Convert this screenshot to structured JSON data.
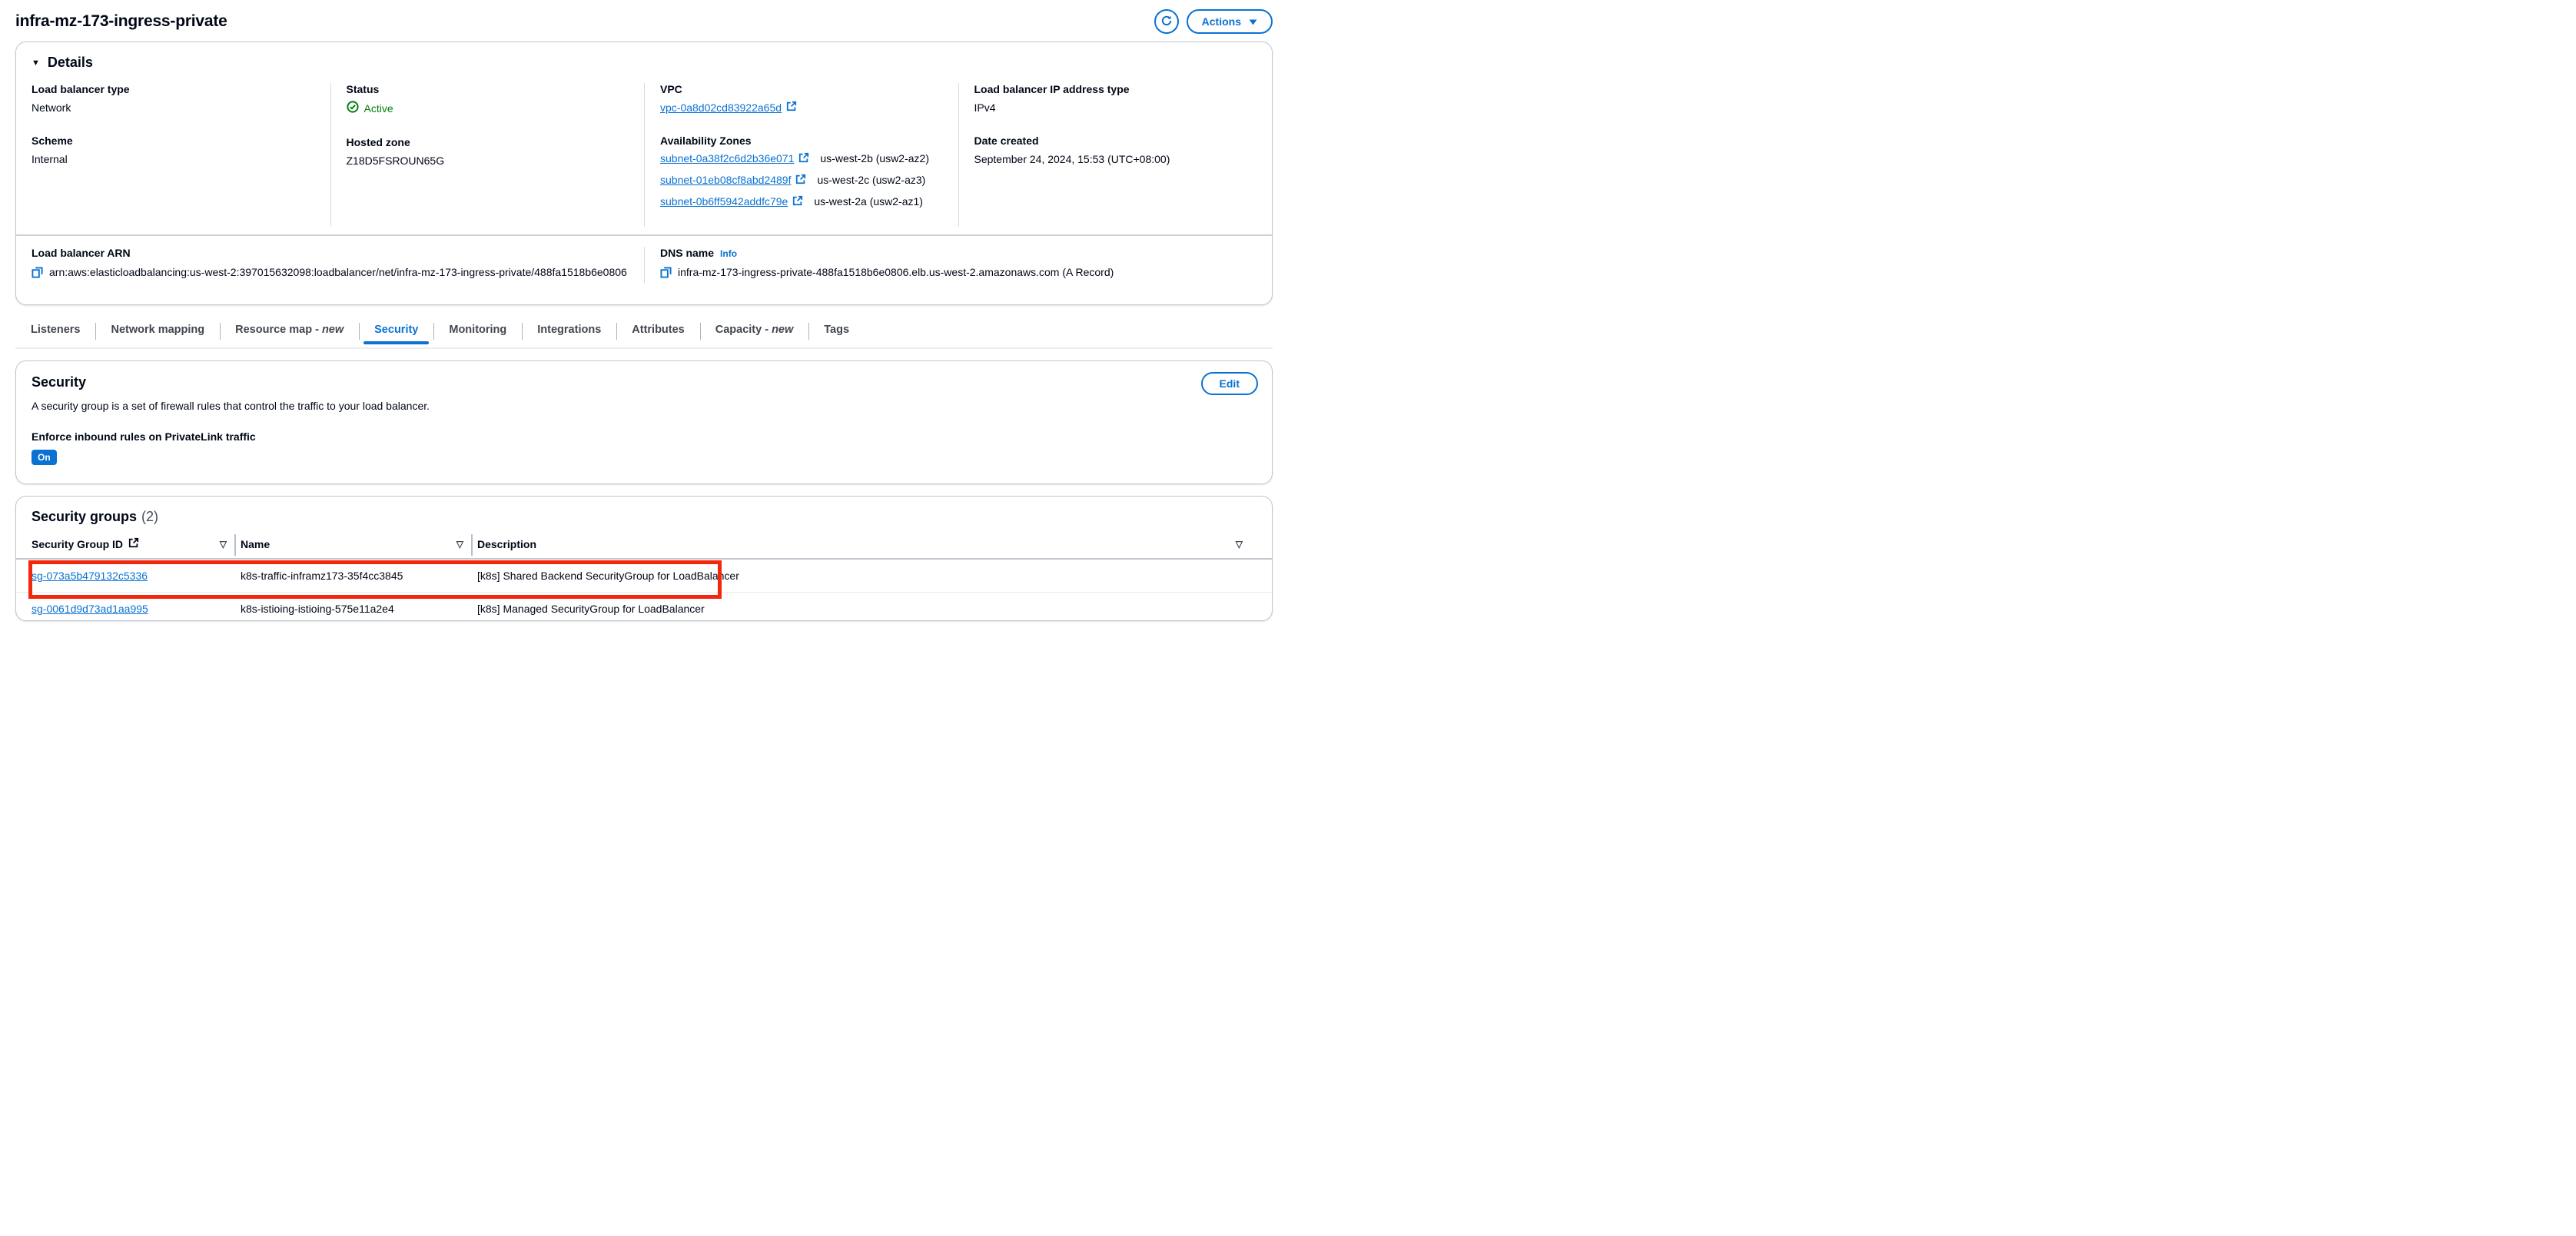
{
  "colors": {
    "accent": "#0972d3",
    "success": "#037f0c",
    "annotation": "#f2270c"
  },
  "header": {
    "title": "infra-mz-173-ingress-private",
    "actions_label": "Actions"
  },
  "details": {
    "title": "Details",
    "lb_type_label": "Load balancer type",
    "lb_type_value": "Network",
    "scheme_label": "Scheme",
    "scheme_value": "Internal",
    "status_label": "Status",
    "status_value": "Active",
    "hosted_zone_label": "Hosted zone",
    "hosted_zone_value": "Z18D5FSROUN65G",
    "vpc_label": "VPC",
    "vpc_link": "vpc-0a8d02cd83922a65d",
    "az_label": "Availability Zones",
    "subnets": [
      {
        "link": "subnet-0a38f2c6d2b36e071",
        "zone": "us-west-2b (usw2-az2)"
      },
      {
        "link": "subnet-01eb08cf8abd2489f",
        "zone": "us-west-2c (usw2-az3)"
      },
      {
        "link": "subnet-0b6ff5942addfc79e",
        "zone": "us-west-2a (usw2-az1)"
      }
    ],
    "ip_type_label": "Load balancer IP address type",
    "ip_type_value": "IPv4",
    "date_created_label": "Date created",
    "date_created_value": "September 24, 2024, 15:53 (UTC+08:00)",
    "arn_label": "Load balancer ARN",
    "arn_value": "arn:aws:elasticloadbalancing:us-west-2:397015632098:loadbalancer/net/infra-mz-173-ingress-private/488fa1518b6e0806",
    "dns_label": "DNS name",
    "dns_info": "Info",
    "dns_value": "infra-mz-173-ingress-private-488fa1518b6e0806.elb.us-west-2.amazonaws.com (A Record)"
  },
  "tabs": [
    {
      "label": "Listeners"
    },
    {
      "label": "Network mapping"
    },
    {
      "label": "Resource map -",
      "suffix": "new"
    },
    {
      "label": "Security",
      "active": true
    },
    {
      "label": "Monitoring"
    },
    {
      "label": "Integrations"
    },
    {
      "label": "Attributes"
    },
    {
      "label": "Capacity -",
      "suffix": "new"
    },
    {
      "label": "Tags"
    }
  ],
  "security": {
    "title": "Security",
    "edit_label": "Edit",
    "description": "A security group is a set of firewall rules that control the traffic to your load balancer.",
    "privatelink_label": "Enforce inbound rules on PrivateLink traffic",
    "privatelink_value": "On"
  },
  "security_groups": {
    "title": "Security groups",
    "count": "(2)",
    "columns": {
      "id": "Security Group ID",
      "name": "Name",
      "description": "Description"
    },
    "rows": [
      {
        "id": "sg-073a5b479132c5336",
        "name": "k8s-traffic-inframz173-35f4cc3845",
        "description": "[k8s] Shared Backend SecurityGroup for LoadBalancer"
      },
      {
        "id": "sg-0061d9d73ad1aa995",
        "name": "k8s-istioing-istioing-575e11a2e4",
        "description": "[k8s] Managed SecurityGroup for LoadBalancer"
      }
    ]
  }
}
